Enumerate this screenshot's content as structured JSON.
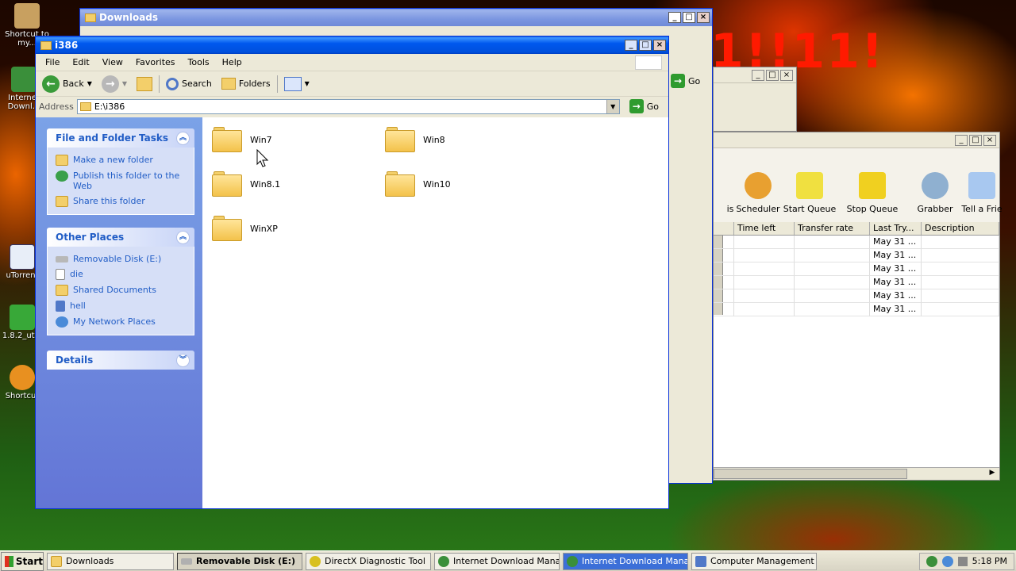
{
  "desktop": {
    "banner_text": "1!!11!",
    "icons": [
      {
        "label": "Shortcut to my..."
      },
      {
        "label": "Internet Downl..."
      },
      {
        "label": "uTorrent"
      },
      {
        "label": "1.8.2_ut..."
      },
      {
        "label": "Shortcut"
      }
    ]
  },
  "downloads_window": {
    "title": "Downloads",
    "go_label": "Go"
  },
  "idm_window": {
    "toolbar": [
      "is",
      "Scheduler",
      "Start Queue",
      "Stop Queue",
      "Grabber",
      "Tell a Frie"
    ],
    "columns": [
      "Time left",
      "Transfer rate",
      "Last Try...",
      "Description"
    ],
    "rows": [
      {
        "last_try": "May 31 ..."
      },
      {
        "last_try": "May 31 ..."
      },
      {
        "last_try": "May 31 ..."
      },
      {
        "last_try": "May 31 ..."
      },
      {
        "last_try": "May 31 ..."
      },
      {
        "last_try": "May 31 ..."
      }
    ]
  },
  "explorer": {
    "title": "i386",
    "menu": [
      "File",
      "Edit",
      "View",
      "Favorites",
      "Tools",
      "Help"
    ],
    "toolbar": {
      "back": "Back",
      "search": "Search",
      "folders": "Folders"
    },
    "address_label": "Address",
    "address_value": "E:\\i386",
    "go_label": "Go",
    "file_tasks": {
      "title": "File and Folder Tasks",
      "items": [
        "Make a new folder",
        "Publish this folder to the Web",
        "Share this folder"
      ]
    },
    "other_places": {
      "title": "Other Places",
      "items": [
        "Removable Disk (E:)",
        "die",
        "Shared Documents",
        "hell",
        "My Network Places"
      ]
    },
    "details": {
      "title": "Details"
    },
    "folders": [
      "Win7",
      "Win8",
      "Win8.1",
      "Win10",
      "WinXP"
    ]
  },
  "taskbar": {
    "start": "Start",
    "buttons": [
      "Downloads",
      "Removable Disk (E:)",
      "DirectX Diagnostic Tool",
      "Internet Download Mana...",
      "Internet Download Mana...",
      "Computer Management"
    ],
    "clock": "5:18 PM"
  }
}
